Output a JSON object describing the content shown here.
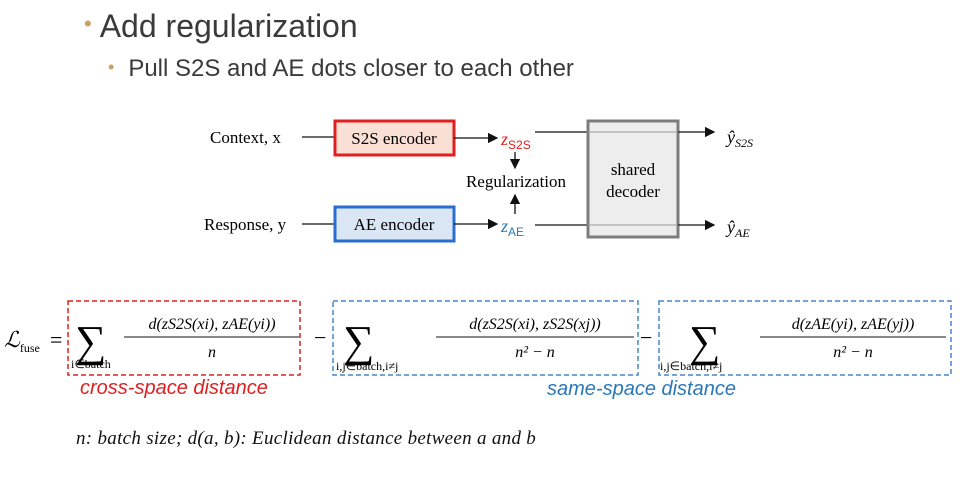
{
  "bullets": {
    "main": "Add regularization",
    "sub": "Pull S2S and AE dots closer to each other"
  },
  "diagram": {
    "context_label": "Context, x",
    "response_label": "Response, y",
    "s2s_encoder": "S2S encoder",
    "ae_encoder": "AE encoder",
    "z_s2s_sub": "S2S",
    "z_ae_sub": "AE",
    "z_letter": "z",
    "regularization": "Regularization",
    "decoder_line1": "shared",
    "decoder_line2": "decoder",
    "y_s2s_sub": "S2S",
    "y_ae_sub": "AE",
    "y_letter": "ŷ"
  },
  "formula": {
    "lhs": "ℒ",
    "lhs_sub": "fuse",
    "sum1_index": "i∈batch",
    "term1_num": "d(zS2S(xi), zAE(yi))",
    "term1_den": "n",
    "sum2_index": "i,j∈batch,i≠j",
    "term2_num": "d(zS2S(xi), zS2S(xj))",
    "term2_den": "n² − n",
    "sum3_index": "i,j∈batch,i≠j",
    "term3_num": "d(zAE(yi), zAE(yj))",
    "term3_den": "n² − n"
  },
  "captions": {
    "cross": "cross-space distance",
    "same": "same-space distance"
  },
  "footnote": "n: batch size; d(a, b): Euclidean distance between a and b",
  "colors": {
    "red": "#e02020",
    "blue": "#2a78b8",
    "s2s_fill": "#f9dfd4",
    "ae_fill": "#dbe6f5",
    "decoder_fill": "#ededed",
    "bullet": "#c9a15a"
  }
}
